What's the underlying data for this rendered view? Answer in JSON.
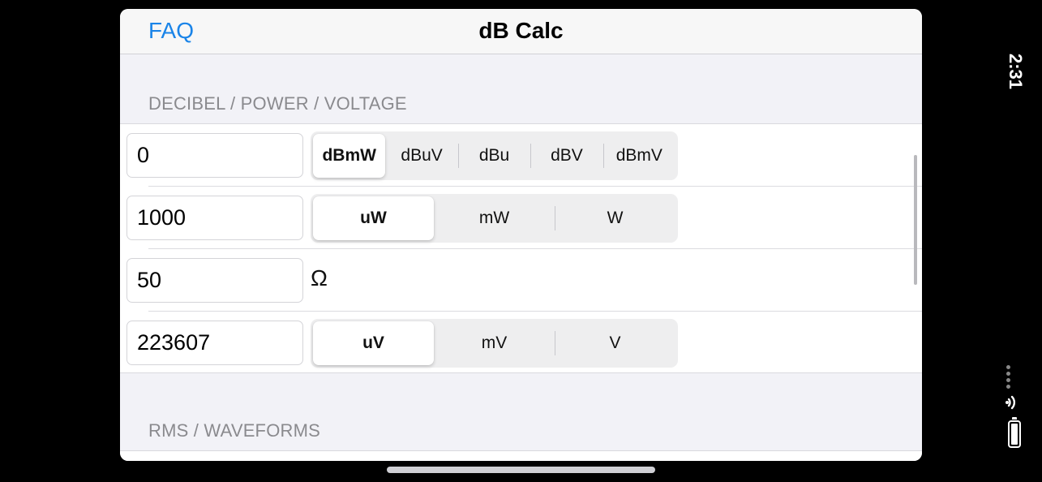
{
  "navbar": {
    "left_button": "FAQ",
    "title": "dB Calc"
  },
  "section1": {
    "header": "DECIBEL / POWER / VOLTAGE",
    "rows": [
      {
        "value": "0",
        "segments": [
          "dBmW",
          "dBuV",
          "dBu",
          "dBV",
          "dBmV"
        ],
        "selected": 0
      },
      {
        "value": "1000",
        "segments": [
          "uW",
          "mW",
          "W"
        ],
        "selected": 0
      },
      {
        "value": "50",
        "unit": "Ω"
      },
      {
        "value": "223607",
        "segments": [
          "uV",
          "mV",
          "V"
        ],
        "selected": 0
      }
    ]
  },
  "section2": {
    "header": "RMS / WAVEFORMS"
  },
  "status_bar": {
    "time": "2:31",
    "icons": [
      "ellipsis-icon",
      "wifi-icon",
      "battery-icon"
    ]
  },
  "colors": {
    "accent": "#1a84e8",
    "background": "#f2f2f7",
    "section_header": "#8a8a8e"
  }
}
